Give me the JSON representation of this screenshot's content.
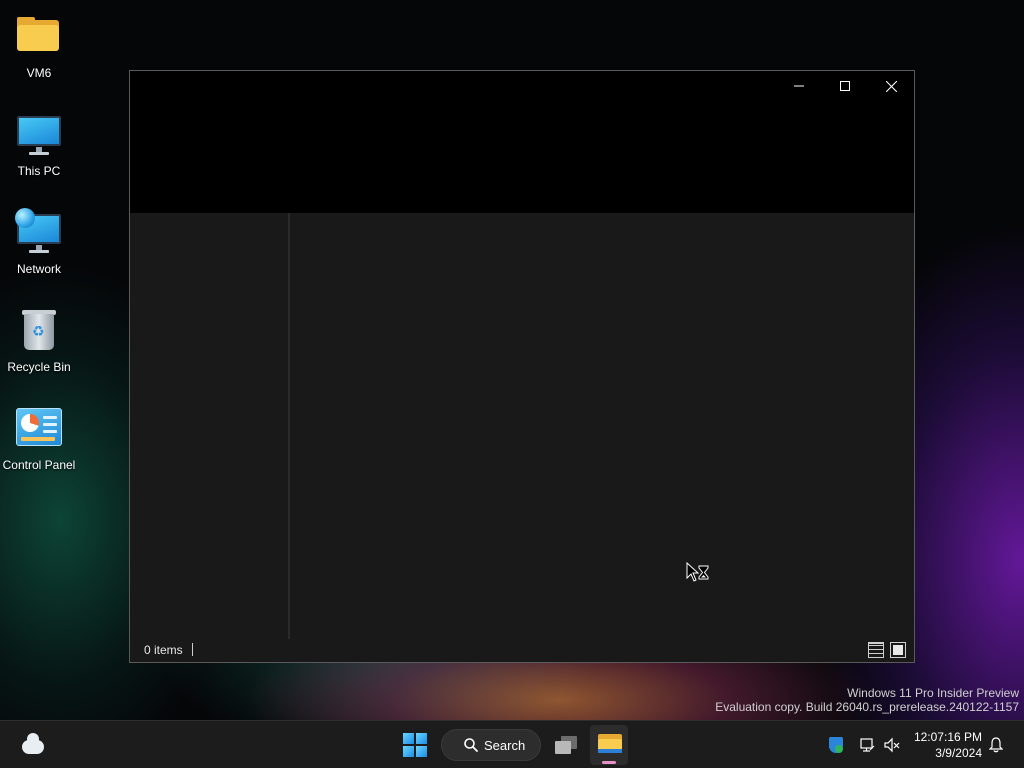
{
  "desktop": {
    "icons": [
      {
        "label": "VM6",
        "icon": "folder-icon"
      },
      {
        "label": "This PC",
        "icon": "monitor-icon"
      },
      {
        "label": "Network",
        "icon": "network-icon"
      },
      {
        "label": "Recycle Bin",
        "icon": "recycle-bin-icon"
      },
      {
        "label": "Control Panel",
        "icon": "control-panel-icon"
      }
    ]
  },
  "window": {
    "controls": {
      "minimize": "minimize-icon",
      "maximize": "maximize-icon",
      "close": "close-icon"
    },
    "status": {
      "item_count": "0 items"
    }
  },
  "watermark": {
    "line1": "Windows 11 Pro Insider Preview",
    "line2": "Evaluation copy. Build 26040.rs_prerelease.240122-1157"
  },
  "taskbar": {
    "search_label": "Search",
    "clock": {
      "time": "12:07:16 PM",
      "date": "3/9/2024"
    }
  },
  "colors": {
    "taskbar_bg": "#1c1c1c",
    "window_content_bg": "#191919",
    "titlebar_bg": "#000000",
    "explorer_active_indicator": "#e691c5"
  }
}
